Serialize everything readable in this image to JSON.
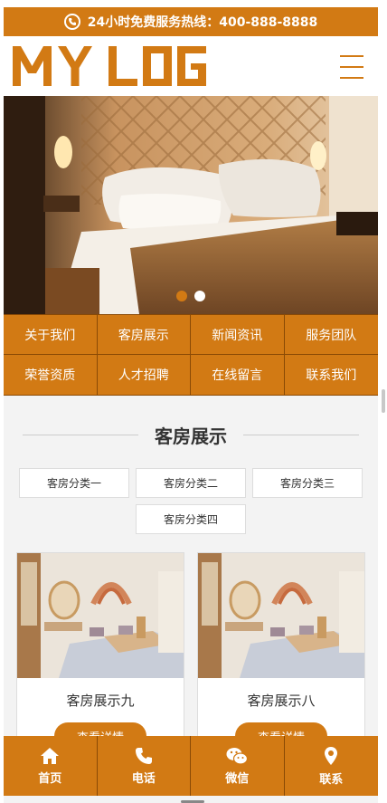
{
  "hotline": {
    "text": "24小时免费服务热线：400-888-8888",
    "icon": "phone-icon"
  },
  "header": {
    "logo_text": "MY LOGO",
    "menu_icon": "hamburger-icon"
  },
  "banner": {
    "slide_count": 2,
    "active_slide": 1
  },
  "nav": {
    "items": [
      {
        "label": "关于我们"
      },
      {
        "label": "客房展示"
      },
      {
        "label": "新闻资讯"
      },
      {
        "label": "服务团队"
      },
      {
        "label": "荣誉资质"
      },
      {
        "label": "人才招聘"
      },
      {
        "label": "在线留言"
      },
      {
        "label": "联系我们"
      }
    ]
  },
  "section": {
    "title": "客房展示"
  },
  "categories": [
    {
      "label": "客房分类一"
    },
    {
      "label": "客房分类二"
    },
    {
      "label": "客房分类三"
    },
    {
      "label": "客房分类四"
    }
  ],
  "cards": [
    {
      "title": "客房展示九",
      "button": "查看详情"
    },
    {
      "title": "客房展示八",
      "button": "查看详情"
    }
  ],
  "bottom_bar": [
    {
      "label": "首页",
      "icon": "home-icon"
    },
    {
      "label": "电话",
      "icon": "phone-icon"
    },
    {
      "label": "微信",
      "icon": "wechat-icon"
    },
    {
      "label": "联系",
      "icon": "location-pin-icon"
    }
  ],
  "colors": {
    "accent": "#d27a14",
    "divider": "#8a4a05",
    "background": "#f3f3f3"
  }
}
